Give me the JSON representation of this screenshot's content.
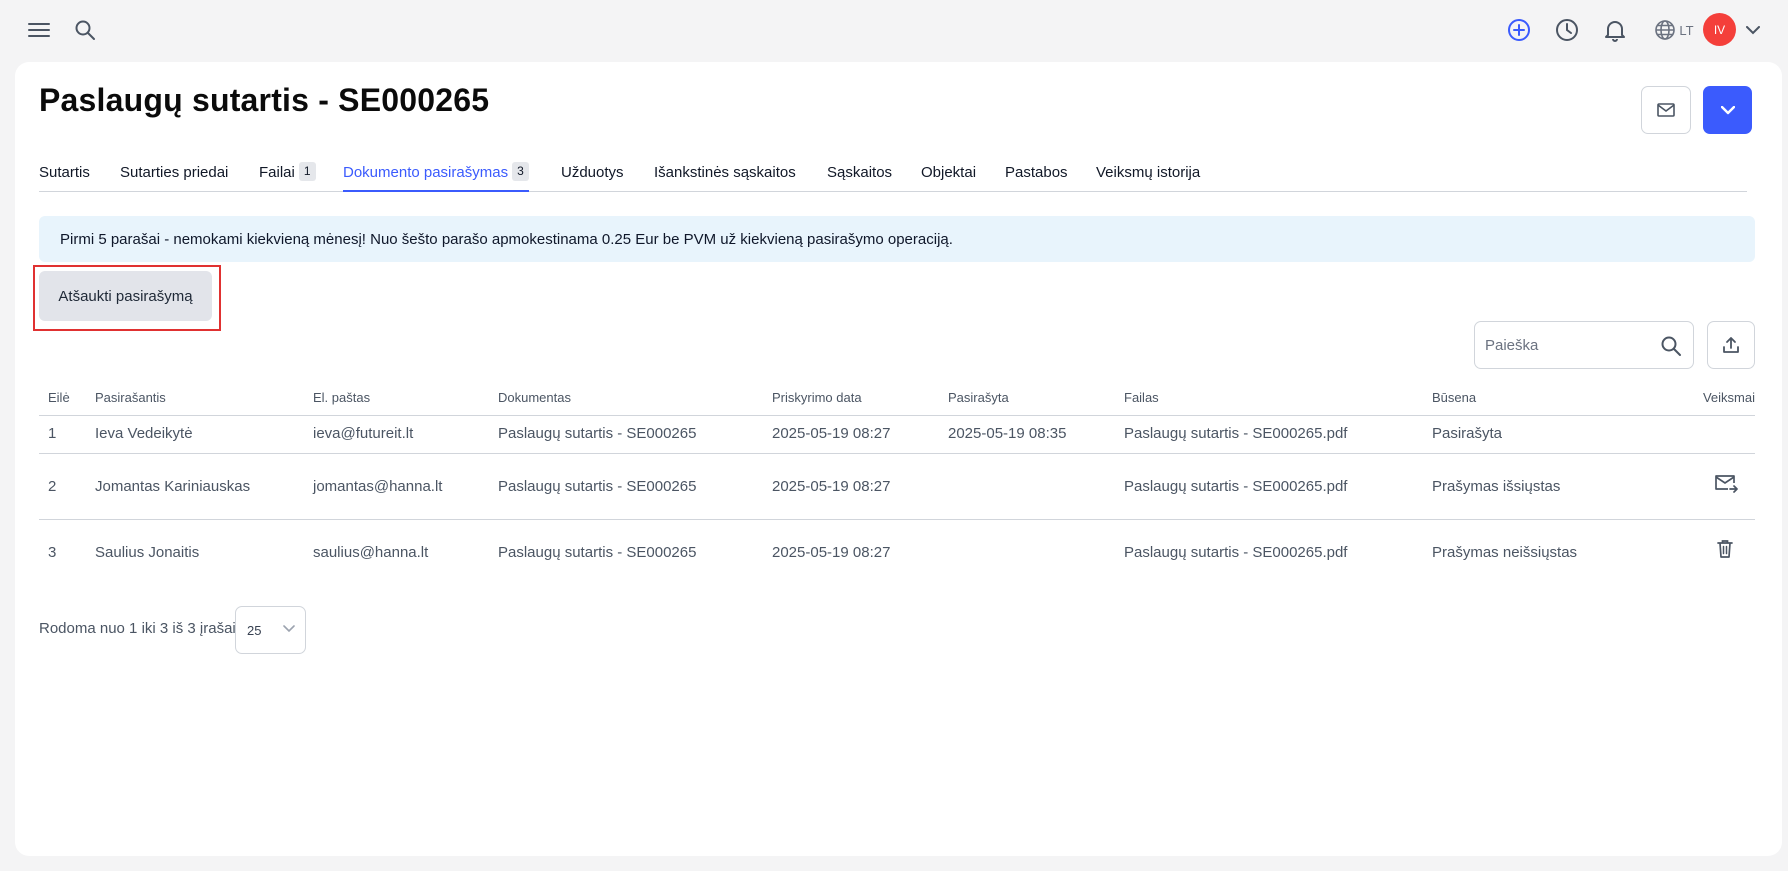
{
  "topbar": {
    "language": "LT",
    "avatar_initials": "IV"
  },
  "page": {
    "title": "Paslaugų sutartis - SE000265"
  },
  "tabs": [
    {
      "label": "Sutartis",
      "badge": null
    },
    {
      "label": "Sutarties priedai",
      "badge": null
    },
    {
      "label": "Failai",
      "badge": "1"
    },
    {
      "label": "Dokumento pasirašymas",
      "badge": "3",
      "active": true
    },
    {
      "label": "Užduotys",
      "badge": null
    },
    {
      "label": "Išankstinės sąskaitos",
      "badge": null
    },
    {
      "label": "Sąskaitos",
      "badge": null
    },
    {
      "label": "Objektai",
      "badge": null
    },
    {
      "label": "Pastabos",
      "badge": null
    },
    {
      "label": "Veiksmų istorija",
      "badge": null
    }
  ],
  "banner": {
    "text": "Pirmi 5 parašai - nemokami kiekvieną mėnesį! Nuo šešto parašo apmokestinama 0.25 Eur be PVM už kiekvieną pasirašymo operaciją."
  },
  "actions": {
    "cancel_signing_label": "Atšaukti pasirašymą"
  },
  "search": {
    "placeholder": "Paieška",
    "value": ""
  },
  "table": {
    "columns": [
      "Eilė",
      "Pasirašantis",
      "El. paštas",
      "Dokumentas",
      "Priskyrimo data",
      "Pasirašyta",
      "Failas",
      "Būsena",
      "Veiksmai"
    ],
    "rows": [
      {
        "order": "1",
        "signer": "Ieva Vedeikytė",
        "email": "ieva@futureit.lt",
        "document": "Paslaugų sutartis - SE000265",
        "assigned": "2025-05-19 08:27",
        "signed": "2025-05-19 08:35",
        "file": "Paslaugų sutartis - SE000265.pdf",
        "status": "Pasirašyta",
        "action": null
      },
      {
        "order": "2",
        "signer": "Jomantas Kariniauskas",
        "email": "jomantas@hanna.lt",
        "document": "Paslaugų sutartis - SE000265",
        "assigned": "2025-05-19 08:27",
        "signed": "",
        "file": "Paslaugų sutartis - SE000265.pdf",
        "status": "Prašymas išsiųstas",
        "action": "resend-mail-icon"
      },
      {
        "order": "3",
        "signer": "Saulius Jonaitis",
        "email": "saulius@hanna.lt",
        "document": "Paslaugų sutartis - SE000265",
        "assigned": "2025-05-19 08:27",
        "signed": "",
        "file": "Paslaugų sutartis - SE000265.pdf",
        "status": "Prašymas neišsiųstas",
        "action": "delete-icon"
      }
    ]
  },
  "pagination": {
    "summary": "Rodoma nuo 1 iki 3 iš 3 įrašai",
    "per_page": "25"
  },
  "colors": {
    "accent": "#3b5bfd",
    "avatar": "#f43f3a",
    "banner_bg": "#e8f4fc",
    "highlight_outline": "#e03131"
  }
}
